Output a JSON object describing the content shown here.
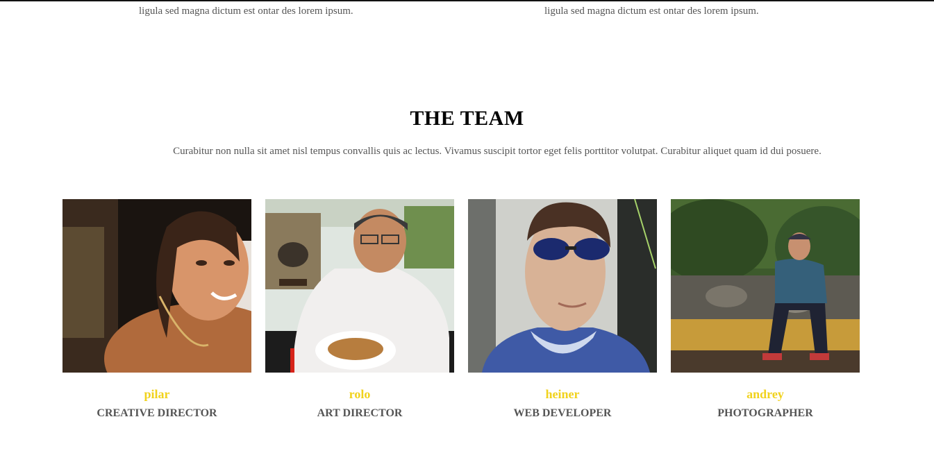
{
  "previous_section": {
    "left_text": "ligula sed magna dictum est ontar des lorem ipsum.",
    "right_text": "ligula sed magna dictum est ontar des lorem ipsum."
  },
  "team_section": {
    "title": "THE TEAM",
    "description": "Curabitur non nulla sit amet nisl tempus convallis quis ac lectus. Vivamus suscipit tortor eget felis porttitor volutpat. Curabitur aliquet quam id dui posuere.",
    "members": [
      {
        "name": "pilar",
        "role": "CREATIVE DIRECTOR"
      },
      {
        "name": "rolo",
        "role": "ART DIRECTOR"
      },
      {
        "name": "heiner",
        "role": "WEB DEVELOPER"
      },
      {
        "name": "andrey",
        "role": "PHOTOGRAPHER"
      }
    ]
  },
  "colors": {
    "name_accent": "#f1d21d",
    "role_text": "#555555",
    "title_text": "#000000"
  }
}
